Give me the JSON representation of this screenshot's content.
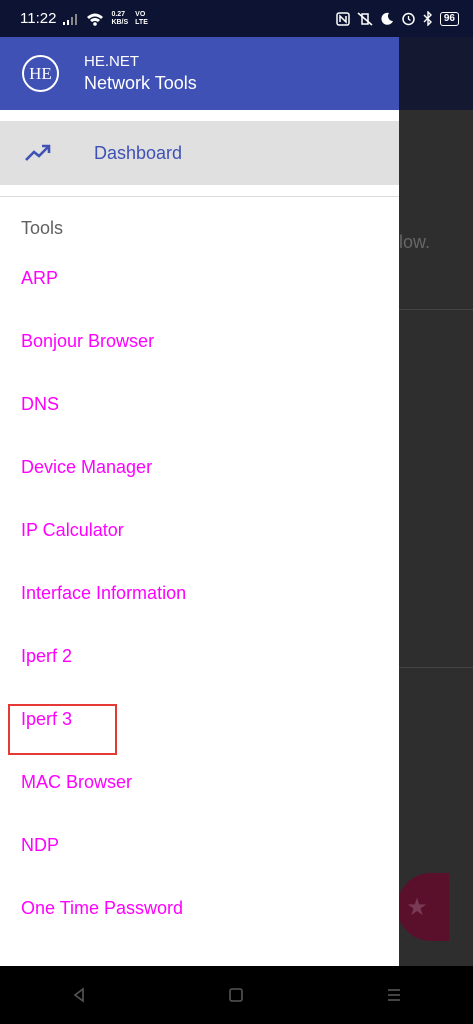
{
  "status_bar": {
    "time": "11:22",
    "net_speed_value": "0.27",
    "net_speed_unit": "KB/S",
    "volte_top": "VO",
    "volte_bottom": "LTE",
    "battery": "96"
  },
  "drawer": {
    "logo_text": "HE",
    "brand_line1": "HE.NET",
    "brand_line2": "Network Tools",
    "dashboard_label": "Dashboard",
    "section_title": "Tools",
    "tools": [
      "ARP",
      "Bonjour Browser",
      "DNS",
      "Device Manager",
      "IP Calculator",
      "Interface Information",
      "Iperf 2",
      "Iperf 3",
      "MAC Browser",
      "NDP",
      "One Time Password"
    ]
  },
  "background_app": {
    "partial_text": "low."
  },
  "colors": {
    "header": "#3f51b5",
    "tool_text": "#ff00ff",
    "highlight_box": "#e53935",
    "status_bar": "#0d1433"
  }
}
